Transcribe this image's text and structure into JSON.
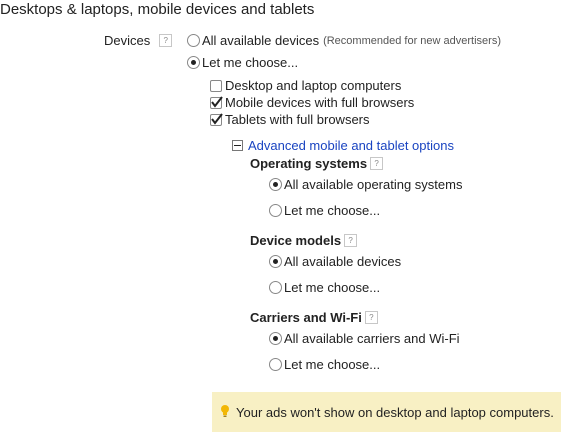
{
  "section": {
    "title": "Desktops & laptops, mobile devices and tablets"
  },
  "devices": {
    "label": "Devices",
    "help": "?",
    "option_all": "All available devices",
    "option_all_note": "(Recommended for new advertisers)",
    "option_choose": "Let me choose...",
    "checkboxes": [
      {
        "label": "Desktop and laptop computers",
        "checked": false
      },
      {
        "label": "Mobile devices with full browsers",
        "checked": true
      },
      {
        "label": "Tablets with full browsers",
        "checked": true
      }
    ]
  },
  "advanced": {
    "toggle_label": "Advanced mobile and tablet options",
    "os": {
      "heading": "Operating systems",
      "help": "?",
      "option_all": "All available operating systems",
      "option_choose": "Let me choose..."
    },
    "models": {
      "heading": "Device models",
      "help": "?",
      "option_all": "All available devices",
      "option_choose": "Let me choose..."
    },
    "carriers": {
      "heading": "Carriers and Wi-Fi",
      "help": "?",
      "option_all": "All available carriers and Wi-Fi",
      "option_choose": "Let me choose..."
    }
  },
  "notice": {
    "text": "Your ads won't show on desktop and laptop computers."
  },
  "colors": {
    "link": "#1a44c1",
    "notice_bg": "#f8f0c4",
    "bulb": "#f2b705"
  }
}
